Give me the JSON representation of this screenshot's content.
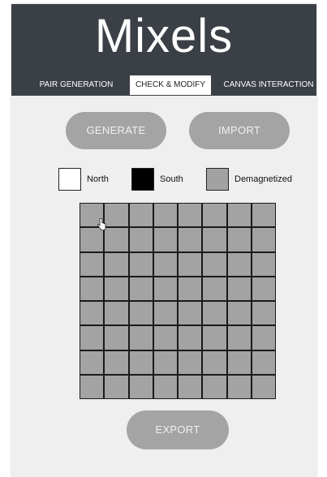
{
  "app": {
    "title": "Mixels"
  },
  "tabs": [
    {
      "label": "PAIR GENERATION",
      "active": false
    },
    {
      "label": "CHECK & MODIFY",
      "active": true
    },
    {
      "label": "CANVAS INTERACTION",
      "active": false
    }
  ],
  "actions": {
    "generate_label": "GENERATE",
    "import_label": "IMPORT",
    "export_label": "EXPORT"
  },
  "legend": {
    "north": {
      "label": "North",
      "color": "#ffffff"
    },
    "south": {
      "label": "South",
      "color": "#000000"
    },
    "demagnetized": {
      "label": "Demagnetized",
      "color": "#a2a2a2"
    }
  },
  "grid": {
    "rows": 8,
    "cols": 8,
    "cell_state": "Demagnetized",
    "cell_color": "#a3a3a3",
    "border_color": "#1a1a1a"
  },
  "colors": {
    "header_bg": "#3b4047",
    "button_bg": "#a4a4a4",
    "panel_bg": "#efefef"
  }
}
